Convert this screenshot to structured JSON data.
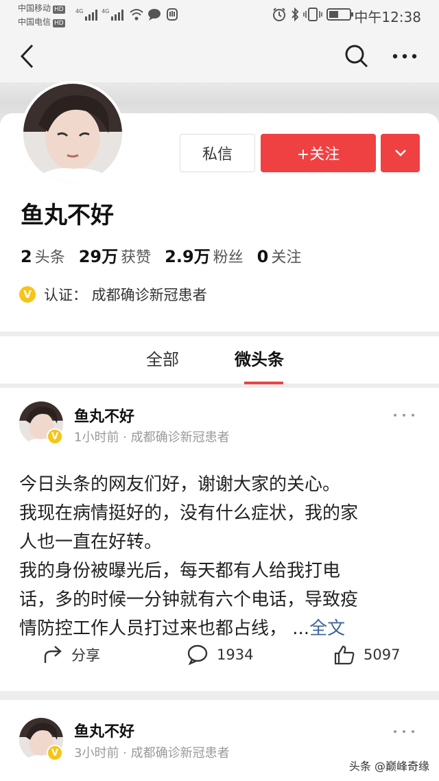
{
  "status_bar": {
    "carrier1": "中国移动",
    "carrier2": "中国电信",
    "hd": "HD",
    "net1": "4G",
    "net2": "4G",
    "time": "中午12:38",
    "icons": [
      "alarm-icon",
      "bluetooth-icon",
      "vibrate-icon",
      "battery-icon"
    ]
  },
  "nav": {
    "icons": [
      "back-icon",
      "search-icon",
      "more-icon"
    ]
  },
  "profile": {
    "message_button": "私信",
    "follow_button": "+关注",
    "username": "鱼丸不好",
    "stats": [
      {
        "value": "2",
        "label": "头条"
      },
      {
        "value": "29万",
        "label": "获赞"
      },
      {
        "value": "2.9万",
        "label": "粉丝"
      },
      {
        "value": "0",
        "label": "关注"
      }
    ],
    "verify_badge": "V",
    "verification": "认证： 成都确诊新冠患者"
  },
  "tabs": [
    {
      "label": "全部",
      "active": false
    },
    {
      "label": "微头条",
      "active": true
    }
  ],
  "colors": {
    "accent": "#f04142",
    "badge": "#f5c518",
    "link": "#406599"
  },
  "posts": [
    {
      "author": "鱼丸不好",
      "meta": "1小时前 · 成都确诊新冠患者",
      "lines": [
        "今日头条的网友们好，谢谢大家的关心。",
        "我现在病情挺好的，没有什么症状，我的家",
        "人也一直在好转。",
        "我的身份被曝光后，每天都有人给我打电",
        "话，多的时候一分钟就有六个电话，导致疫",
        "情防控工作人员打过来也都占线，"
      ],
      "ellipsis": "...",
      "more": "全文",
      "share": "分享",
      "comments": "1934",
      "likes": "5097"
    },
    {
      "author": "鱼丸不好",
      "meta": "3小时前 · 成都确诊新冠患者"
    }
  ],
  "watermark": "头条 @巅峰奇缘"
}
